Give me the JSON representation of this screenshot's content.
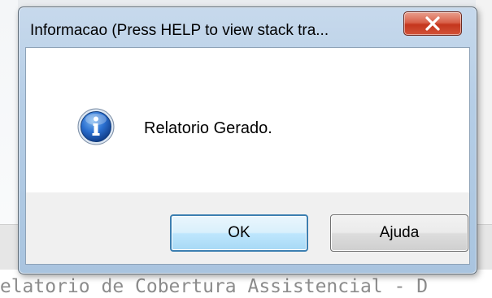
{
  "window": {
    "title": "Informacao (Press HELP to view stack tra...",
    "close_icon": "close-icon"
  },
  "dialog": {
    "icon": "info-icon",
    "message": "Relatorio Gerado.",
    "buttons": {
      "ok_label": "OK",
      "help_label": "Ajuda"
    }
  },
  "background": {
    "status_text": "Relatorio de Cobertura Assistencial - D"
  },
  "colors": {
    "ok_border": "#3c7fb1",
    "close_red": "#c5361d",
    "info_blue": "#1f5fb8"
  }
}
